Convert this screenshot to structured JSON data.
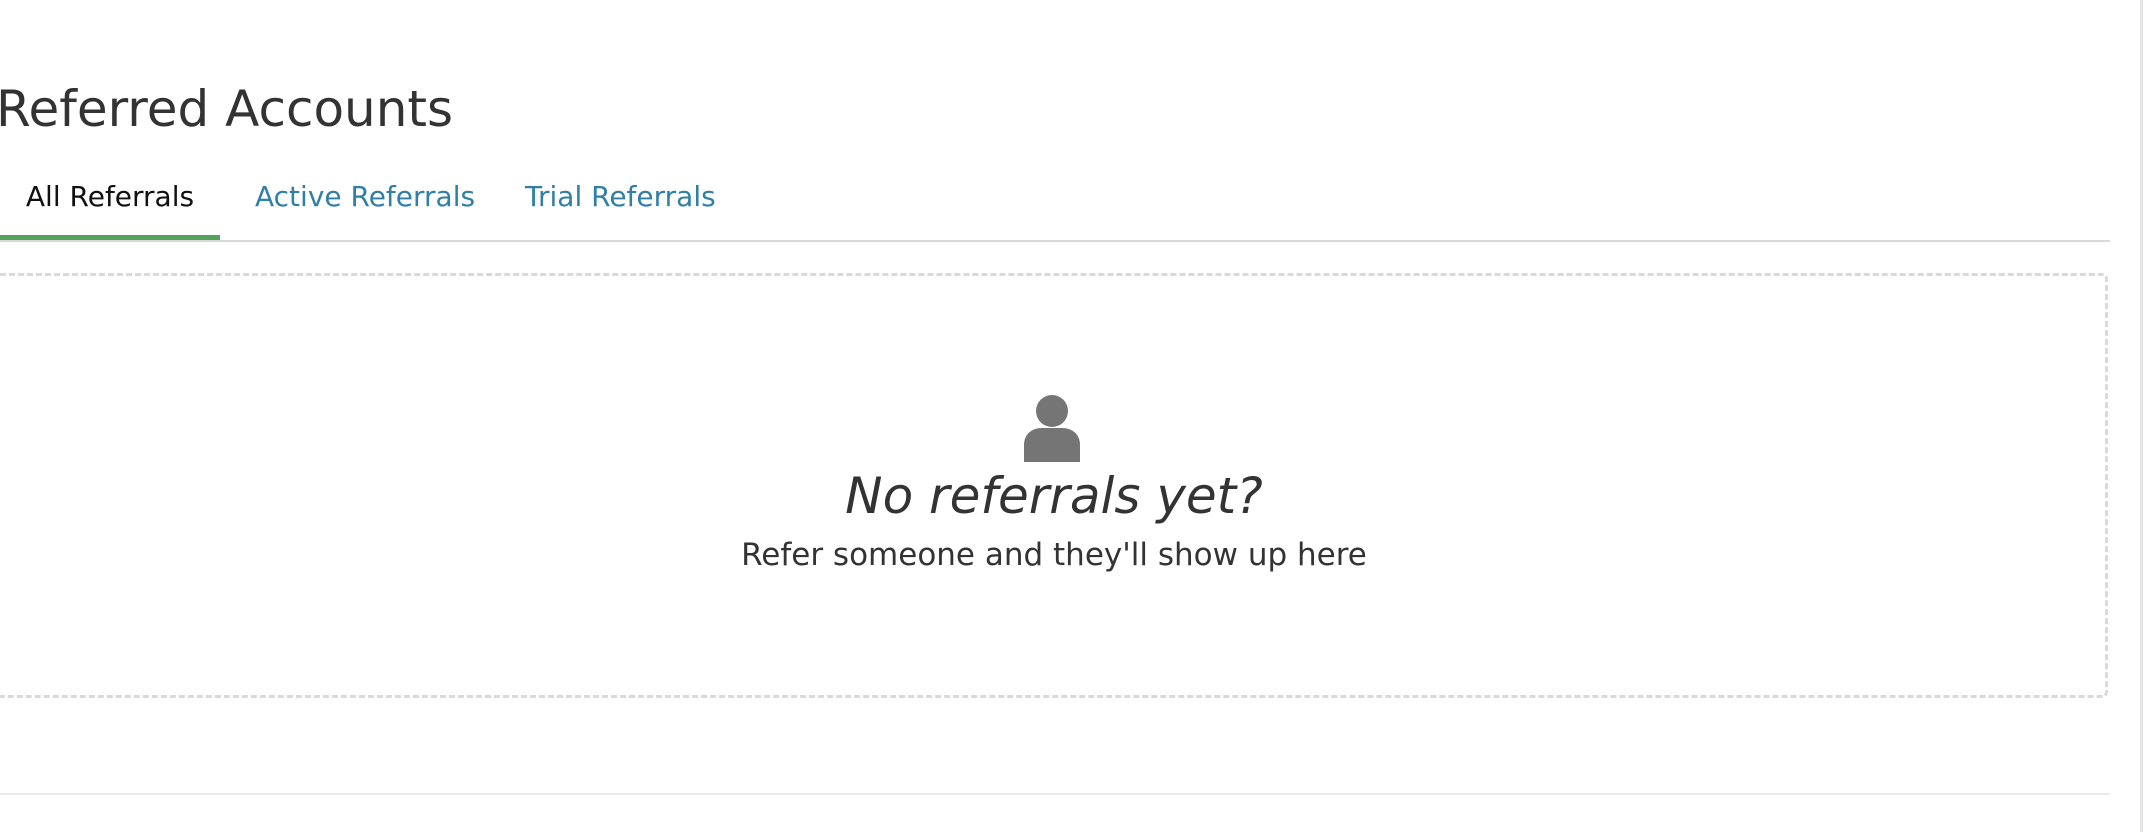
{
  "header": {
    "title": "Referred Accounts"
  },
  "tabs": [
    {
      "label": "All Referrals",
      "active": true
    },
    {
      "label": "Active Referrals",
      "active": false
    },
    {
      "label": "Trial Referrals",
      "active": false
    }
  ],
  "empty_state": {
    "icon": "person-icon",
    "heading": "No referrals yet?",
    "message": "Refer someone and they'll show up here"
  },
  "colors": {
    "active_tab_underline": "#55a35a",
    "inactive_tab_text": "#2f7fa6",
    "icon": "#757575"
  }
}
